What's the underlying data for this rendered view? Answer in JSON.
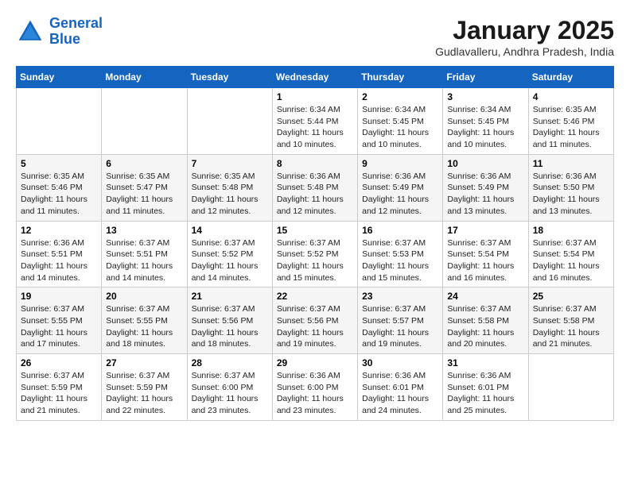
{
  "logo": {
    "line1": "General",
    "line2": "Blue"
  },
  "title": "January 2025",
  "subtitle": "Gudlavalleru, Andhra Pradesh, India",
  "days_of_week": [
    "Sunday",
    "Monday",
    "Tuesday",
    "Wednesday",
    "Thursday",
    "Friday",
    "Saturday"
  ],
  "weeks": [
    [
      {
        "day": "",
        "info": ""
      },
      {
        "day": "",
        "info": ""
      },
      {
        "day": "",
        "info": ""
      },
      {
        "day": "1",
        "info": "Sunrise: 6:34 AM\nSunset: 5:44 PM\nDaylight: 11 hours\nand 10 minutes."
      },
      {
        "day": "2",
        "info": "Sunrise: 6:34 AM\nSunset: 5:45 PM\nDaylight: 11 hours\nand 10 minutes."
      },
      {
        "day": "3",
        "info": "Sunrise: 6:34 AM\nSunset: 5:45 PM\nDaylight: 11 hours\nand 10 minutes."
      },
      {
        "day": "4",
        "info": "Sunrise: 6:35 AM\nSunset: 5:46 PM\nDaylight: 11 hours\nand 11 minutes."
      }
    ],
    [
      {
        "day": "5",
        "info": "Sunrise: 6:35 AM\nSunset: 5:46 PM\nDaylight: 11 hours\nand 11 minutes."
      },
      {
        "day": "6",
        "info": "Sunrise: 6:35 AM\nSunset: 5:47 PM\nDaylight: 11 hours\nand 11 minutes."
      },
      {
        "day": "7",
        "info": "Sunrise: 6:35 AM\nSunset: 5:48 PM\nDaylight: 11 hours\nand 12 minutes."
      },
      {
        "day": "8",
        "info": "Sunrise: 6:36 AM\nSunset: 5:48 PM\nDaylight: 11 hours\nand 12 minutes."
      },
      {
        "day": "9",
        "info": "Sunrise: 6:36 AM\nSunset: 5:49 PM\nDaylight: 11 hours\nand 12 minutes."
      },
      {
        "day": "10",
        "info": "Sunrise: 6:36 AM\nSunset: 5:49 PM\nDaylight: 11 hours\nand 13 minutes."
      },
      {
        "day": "11",
        "info": "Sunrise: 6:36 AM\nSunset: 5:50 PM\nDaylight: 11 hours\nand 13 minutes."
      }
    ],
    [
      {
        "day": "12",
        "info": "Sunrise: 6:36 AM\nSunset: 5:51 PM\nDaylight: 11 hours\nand 14 minutes."
      },
      {
        "day": "13",
        "info": "Sunrise: 6:37 AM\nSunset: 5:51 PM\nDaylight: 11 hours\nand 14 minutes."
      },
      {
        "day": "14",
        "info": "Sunrise: 6:37 AM\nSunset: 5:52 PM\nDaylight: 11 hours\nand 14 minutes."
      },
      {
        "day": "15",
        "info": "Sunrise: 6:37 AM\nSunset: 5:52 PM\nDaylight: 11 hours\nand 15 minutes."
      },
      {
        "day": "16",
        "info": "Sunrise: 6:37 AM\nSunset: 5:53 PM\nDaylight: 11 hours\nand 15 minutes."
      },
      {
        "day": "17",
        "info": "Sunrise: 6:37 AM\nSunset: 5:54 PM\nDaylight: 11 hours\nand 16 minutes."
      },
      {
        "day": "18",
        "info": "Sunrise: 6:37 AM\nSunset: 5:54 PM\nDaylight: 11 hours\nand 16 minutes."
      }
    ],
    [
      {
        "day": "19",
        "info": "Sunrise: 6:37 AM\nSunset: 5:55 PM\nDaylight: 11 hours\nand 17 minutes."
      },
      {
        "day": "20",
        "info": "Sunrise: 6:37 AM\nSunset: 5:55 PM\nDaylight: 11 hours\nand 18 minutes."
      },
      {
        "day": "21",
        "info": "Sunrise: 6:37 AM\nSunset: 5:56 PM\nDaylight: 11 hours\nand 18 minutes."
      },
      {
        "day": "22",
        "info": "Sunrise: 6:37 AM\nSunset: 5:56 PM\nDaylight: 11 hours\nand 19 minutes."
      },
      {
        "day": "23",
        "info": "Sunrise: 6:37 AM\nSunset: 5:57 PM\nDaylight: 11 hours\nand 19 minutes."
      },
      {
        "day": "24",
        "info": "Sunrise: 6:37 AM\nSunset: 5:58 PM\nDaylight: 11 hours\nand 20 minutes."
      },
      {
        "day": "25",
        "info": "Sunrise: 6:37 AM\nSunset: 5:58 PM\nDaylight: 11 hours\nand 21 minutes."
      }
    ],
    [
      {
        "day": "26",
        "info": "Sunrise: 6:37 AM\nSunset: 5:59 PM\nDaylight: 11 hours\nand 21 minutes."
      },
      {
        "day": "27",
        "info": "Sunrise: 6:37 AM\nSunset: 5:59 PM\nDaylight: 11 hours\nand 22 minutes."
      },
      {
        "day": "28",
        "info": "Sunrise: 6:37 AM\nSunset: 6:00 PM\nDaylight: 11 hours\nand 23 minutes."
      },
      {
        "day": "29",
        "info": "Sunrise: 6:36 AM\nSunset: 6:00 PM\nDaylight: 11 hours\nand 23 minutes."
      },
      {
        "day": "30",
        "info": "Sunrise: 6:36 AM\nSunset: 6:01 PM\nDaylight: 11 hours\nand 24 minutes."
      },
      {
        "day": "31",
        "info": "Sunrise: 6:36 AM\nSunset: 6:01 PM\nDaylight: 11 hours\nand 25 minutes."
      },
      {
        "day": "",
        "info": ""
      }
    ]
  ]
}
